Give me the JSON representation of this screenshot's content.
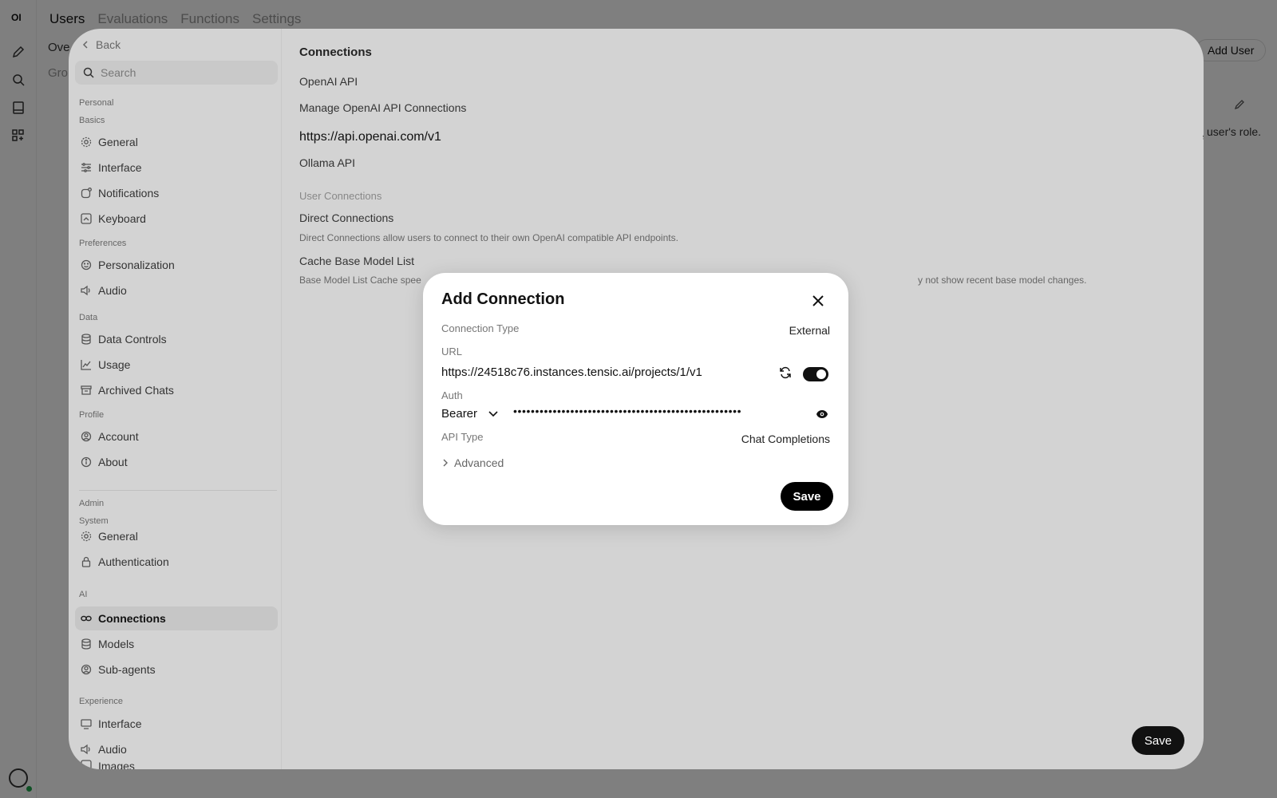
{
  "app": {
    "logo": "OI",
    "nav_tabs": [
      "Users",
      "Evaluations",
      "Functions",
      "Settings"
    ],
    "bg_overview": "Ove",
    "bg_groups": "Gro",
    "add_user": "Add User",
    "role_hint": "user's role."
  },
  "settings": {
    "back": "Back",
    "search_placeholder": "Search",
    "sections": {
      "personal": "Personal",
      "basics": "Basics",
      "preferences": "Preferences",
      "data": "Data",
      "profile": "Profile",
      "admin": "Admin",
      "system": "System",
      "ai": "AI",
      "experience": "Experience"
    },
    "items": {
      "general": "General",
      "interface": "Interface",
      "notifications": "Notifications",
      "keyboard": "Keyboard",
      "personalization": "Personalization",
      "audio": "Audio",
      "data_controls": "Data Controls",
      "usage": "Usage",
      "archived_chats": "Archived Chats",
      "account": "Account",
      "about": "About",
      "sys_general": "General",
      "authentication": "Authentication",
      "connections": "Connections",
      "models": "Models",
      "sub_agents": "Sub-agents",
      "exp_interface": "Interface",
      "exp_audio": "Audio",
      "images": "Images"
    },
    "content": {
      "title": "Connections",
      "openai_api": "OpenAI API",
      "manage_openai": "Manage OpenAI API Connections",
      "openai_url": "https://api.openai.com/v1",
      "ollama_api": "Ollama API",
      "user_connections": "User Connections",
      "direct_connections": "Direct Connections",
      "direct_desc": "Direct Connections allow users to connect to their own OpenAI compatible API endpoints.",
      "cache_list": "Cache Base Model List",
      "cache_desc_left": "Base Model List Cache spee",
      "cache_desc_right": "y not show recent base model changes."
    },
    "save": "Save"
  },
  "dialog": {
    "title": "Add Connection",
    "connection_type_label": "Connection Type",
    "connection_type_value": "External",
    "url_label": "URL",
    "url_value": "https://24518c76.instances.tensic.ai/projects/1/v1",
    "auth_label": "Auth",
    "auth_value": "Bearer",
    "auth_key_masked": "••••••••••••••••••••••••••••••••••••••••••••••••••••",
    "api_type_label": "API Type",
    "api_type_value": "Chat Completions",
    "advanced": "Advanced",
    "save": "Save"
  }
}
